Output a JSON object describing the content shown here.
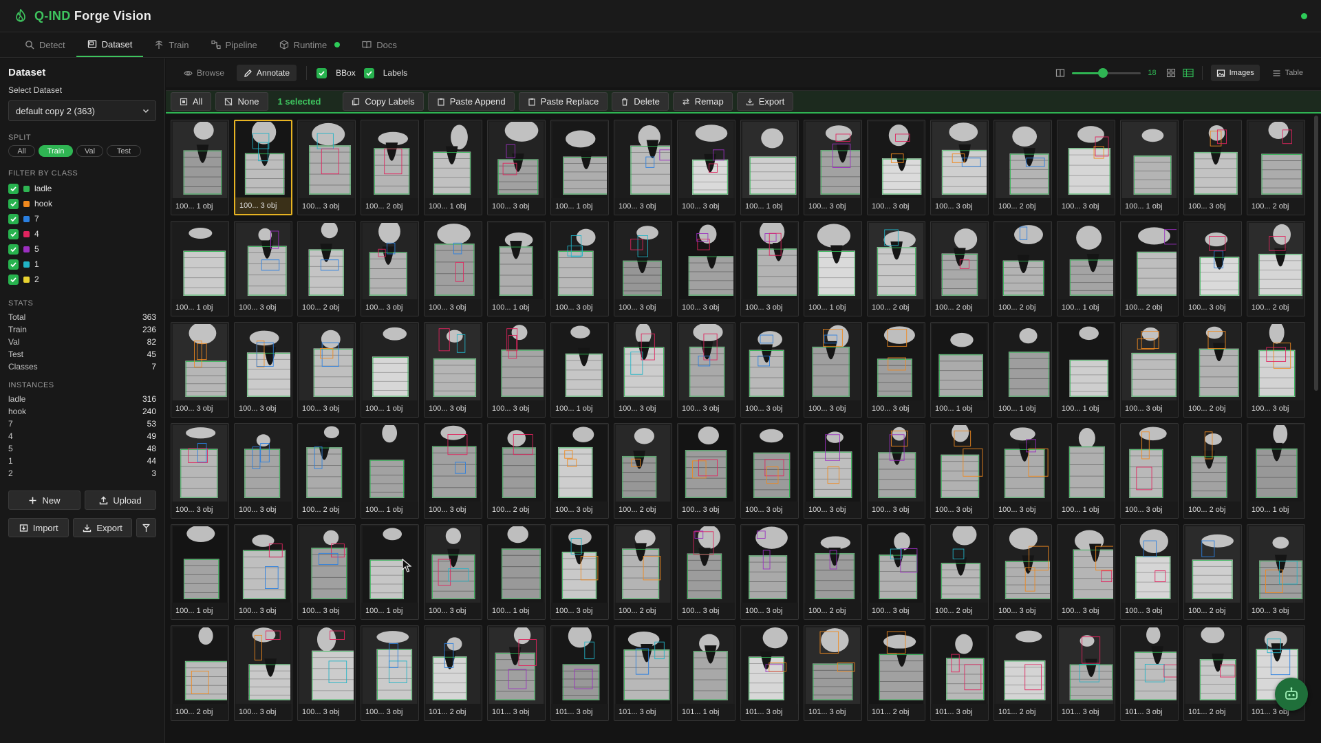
{
  "app": {
    "title_accent": "Q-IND",
    "title_rest": "Forge Vision"
  },
  "nav": {
    "tabs": [
      {
        "label": "Detect",
        "icon": "search-icon"
      },
      {
        "label": "Dataset",
        "icon": "dataset-icon",
        "active": true
      },
      {
        "label": "Train",
        "icon": "train-icon"
      },
      {
        "label": "Pipeline",
        "icon": "pipeline-icon"
      },
      {
        "label": "Runtime",
        "icon": "cube-icon"
      },
      {
        "label": "Docs",
        "icon": "book-icon"
      }
    ]
  },
  "sidebar": {
    "title": "Dataset",
    "select_label": "Select Dataset",
    "selected_dataset": "default copy 2 (363)",
    "split_heading": "SPLIT",
    "split_options": [
      "All",
      "Train",
      "Val",
      "Test"
    ],
    "split_active": "Train",
    "filter_heading": "FILTER BY CLASS",
    "classes": [
      {
        "name": "ladle",
        "color": "#2fb553"
      },
      {
        "name": "hook",
        "color": "#f0891e"
      },
      {
        "name": "7",
        "color": "#2a7fe0"
      },
      {
        "name": "4",
        "color": "#e0245e"
      },
      {
        "name": "5",
        "color": "#9b2fc0"
      },
      {
        "name": "1",
        "color": "#21b3c6"
      },
      {
        "name": "2",
        "color": "#e8d230"
      }
    ],
    "stats_heading": "STATS",
    "stats": [
      {
        "label": "Total",
        "value": "363"
      },
      {
        "label": "Train",
        "value": "236"
      },
      {
        "label": "Val",
        "value": "82"
      },
      {
        "label": "Test",
        "value": "45"
      },
      {
        "label": "Classes",
        "value": "7"
      }
    ],
    "instances_heading": "INSTANCES",
    "instances": [
      {
        "label": "ladle",
        "value": "316"
      },
      {
        "label": "hook",
        "value": "240"
      },
      {
        "label": "7",
        "value": "53"
      },
      {
        "label": "4",
        "value": "49"
      },
      {
        "label": "5",
        "value": "48"
      },
      {
        "label": "1",
        "value": "44"
      },
      {
        "label": "2",
        "value": "3"
      }
    ],
    "buttons": {
      "new": "New",
      "upload": "Upload",
      "import": "Import",
      "export": "Export"
    }
  },
  "toolbar": {
    "browse": "Browse",
    "annotate": "Annotate",
    "bbox": "BBox",
    "labels": "Labels",
    "thumb_size": "18",
    "thumb_size_fraction": 0.45,
    "images": "Images",
    "table": "Table"
  },
  "selection": {
    "all": "All",
    "none": "None",
    "count": "1 selected",
    "copy_labels": "Copy Labels",
    "paste_append": "Paste Append",
    "paste_replace": "Paste Replace",
    "delete": "Delete",
    "remap": "Remap",
    "export": "Export"
  },
  "grid": {
    "selected_index": 1,
    "rows": [
      [
        "100... 1 obj",
        "100... 3 obj",
        "100... 3 obj",
        "100... 2 obj",
        "100... 1 obj",
        "100... 3 obj",
        "100... 1 obj",
        "100... 3 obj",
        "100... 3 obj",
        "100... 1 obj",
        "100... 3 obj",
        "100... 3 obj",
        "100... 3 obj",
        "100... 2 obj",
        "100... 3 obj",
        "100... 1 obj",
        "100... 3 obj",
        "100... 2 obj"
      ],
      [
        "100... 1 obj",
        "100... 3 obj",
        "100... 2 obj",
        "100... 3 obj",
        "100... 3 obj",
        "100... 1 obj",
        "100... 3 obj",
        "100... 3 obj",
        "100... 3 obj",
        "100... 3 obj",
        "100... 1 obj",
        "100... 2 obj",
        "100... 2 obj",
        "100... 2 obj",
        "100... 1 obj",
        "100... 2 obj",
        "100... 3 obj",
        "100... 2 obj"
      ],
      [
        "100... 3 obj",
        "100... 3 obj",
        "100... 3 obj",
        "100... 1 obj",
        "100... 3 obj",
        "100... 3 obj",
        "100... 1 obj",
        "100... 3 obj",
        "100... 3 obj",
        "100... 3 obj",
        "100... 3 obj",
        "100... 3 obj",
        "100... 1 obj",
        "100... 1 obj",
        "100... 1 obj",
        "100... 3 obj",
        "100... 2 obj",
        "100... 3 obj"
      ],
      [
        "100... 3 obj",
        "100... 3 obj",
        "100... 2 obj",
        "100... 1 obj",
        "100... 3 obj",
        "100... 2 obj",
        "100... 3 obj",
        "100... 2 obj",
        "100... 3 obj",
        "100... 3 obj",
        "100... 3 obj",
        "100... 3 obj",
        "100... 3 obj",
        "100... 3 obj",
        "100... 1 obj",
        "100... 3 obj",
        "100... 2 obj",
        "100... 1 obj"
      ],
      [
        "100... 1 obj",
        "100... 3 obj",
        "100... 3 obj",
        "100... 1 obj",
        "100... 3 obj",
        "100... 1 obj",
        "100... 3 obj",
        "100... 2 obj",
        "100... 3 obj",
        "100... 3 obj",
        "100... 2 obj",
        "100... 3 obj",
        "100... 2 obj",
        "100... 3 obj",
        "100... 3 obj",
        "100... 3 obj",
        "100... 2 obj",
        "100... 3 obj"
      ],
      [
        "100... 2 obj",
        "100... 3 obj",
        "100... 3 obj",
        "100... 3 obj",
        "101... 2 obj",
        "101... 3 obj",
        "101... 3 obj",
        "101... 3 obj",
        "101... 1 obj",
        "101... 3 obj",
        "101... 3 obj",
        "101... 2 obj",
        "101... 3 obj",
        "101... 2 obj",
        "101... 3 obj",
        "101... 3 obj",
        "101... 2 obj",
        "101... 3 obj"
      ]
    ]
  }
}
